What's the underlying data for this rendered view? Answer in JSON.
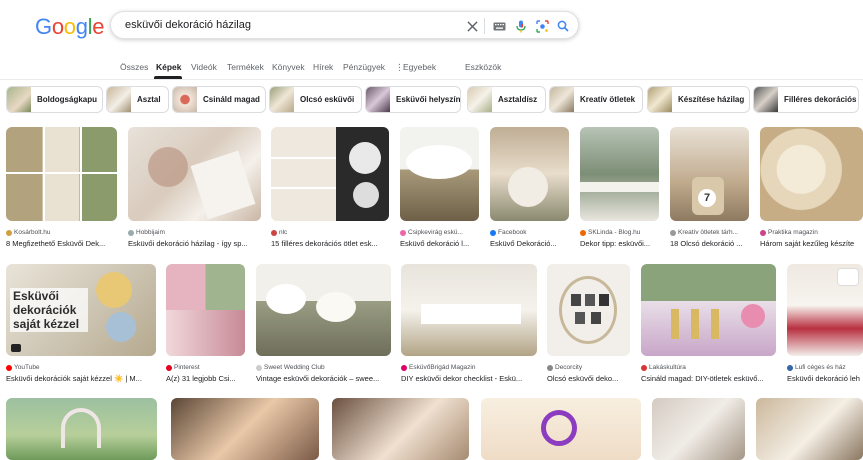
{
  "logo": {
    "letters": [
      "G",
      "o",
      "o",
      "g",
      "l",
      "e"
    ],
    "colors": [
      "#4285F4",
      "#EA4335",
      "#FBBC05",
      "#4285F4",
      "#34A853",
      "#EA4335"
    ]
  },
  "search": {
    "query": "esküvői dekoráció házilag"
  },
  "tabs": [
    "Összes",
    "Képek",
    "Videók",
    "Termékek",
    "Könyvek",
    "Hírek",
    "Pénzügyek",
    "Egyebek",
    "Eszközök"
  ],
  "chips": [
    "Boldogságkapu",
    "Asztal",
    "Csináld magad",
    "Olcsó esküvői",
    "Esküvői helyszín",
    "Asztaldísz",
    "Kreatív ötletek",
    "Készítése házilag",
    "Filléres dekorációs"
  ],
  "row1": [
    {
      "source": "Kosárbolt.hu",
      "title": "8 Megfizethető Esküvői Dek..."
    },
    {
      "source": "Hobbijaim",
      "title": "Esküvői dekoráció házilag - így sp..."
    },
    {
      "source": "nlc",
      "title": "15 filléres dekorációs ötlet esk..."
    },
    {
      "source": "Csipkevirág eskü...",
      "title": "Esküvő dekoráció l..."
    },
    {
      "source": "Facebook",
      "title": "Esküvő Dekoráció..."
    },
    {
      "source": "SKLinda - Blog.hu",
      "title": "Dekor tipp: esküvői..."
    },
    {
      "source": "Kreatív ötletek tárh...",
      "title": "18 Olcsó dekoráció ..."
    },
    {
      "source": "Praktika magazin",
      "title": "Három saját kezűleg készíte"
    }
  ],
  "row2": [
    {
      "source": "YouTube",
      "title": "Esküvői dekorációk saját kézzel ☀️ | M...",
      "overlay": "Esküvői dekorációk saját kézzel"
    },
    {
      "source": "Pinterest",
      "title": "A(z) 31 legjobb Csi..."
    },
    {
      "source": "Sweet Wedding Club",
      "title": "Vintage esküvői dekorációk – swee..."
    },
    {
      "source": "EsküvőBrigád Magazin",
      "title": "DIY esküvői dekor checklist - Eskü..."
    },
    {
      "source": "Decorcity",
      "title": "Olcsó esküvői deko..."
    },
    {
      "source": "Lakáskultúra",
      "title": "Csináld magad: DIY-ötletek esküvő..."
    },
    {
      "source": "Lufi céges és ház",
      "title": "Esküvői dekoráció leh"
    }
  ],
  "row3": [
    {
      "id": 1
    },
    {
      "id": 2
    },
    {
      "id": 3
    },
    {
      "id": 4
    },
    {
      "id": 5
    },
    {
      "id": 6
    }
  ]
}
